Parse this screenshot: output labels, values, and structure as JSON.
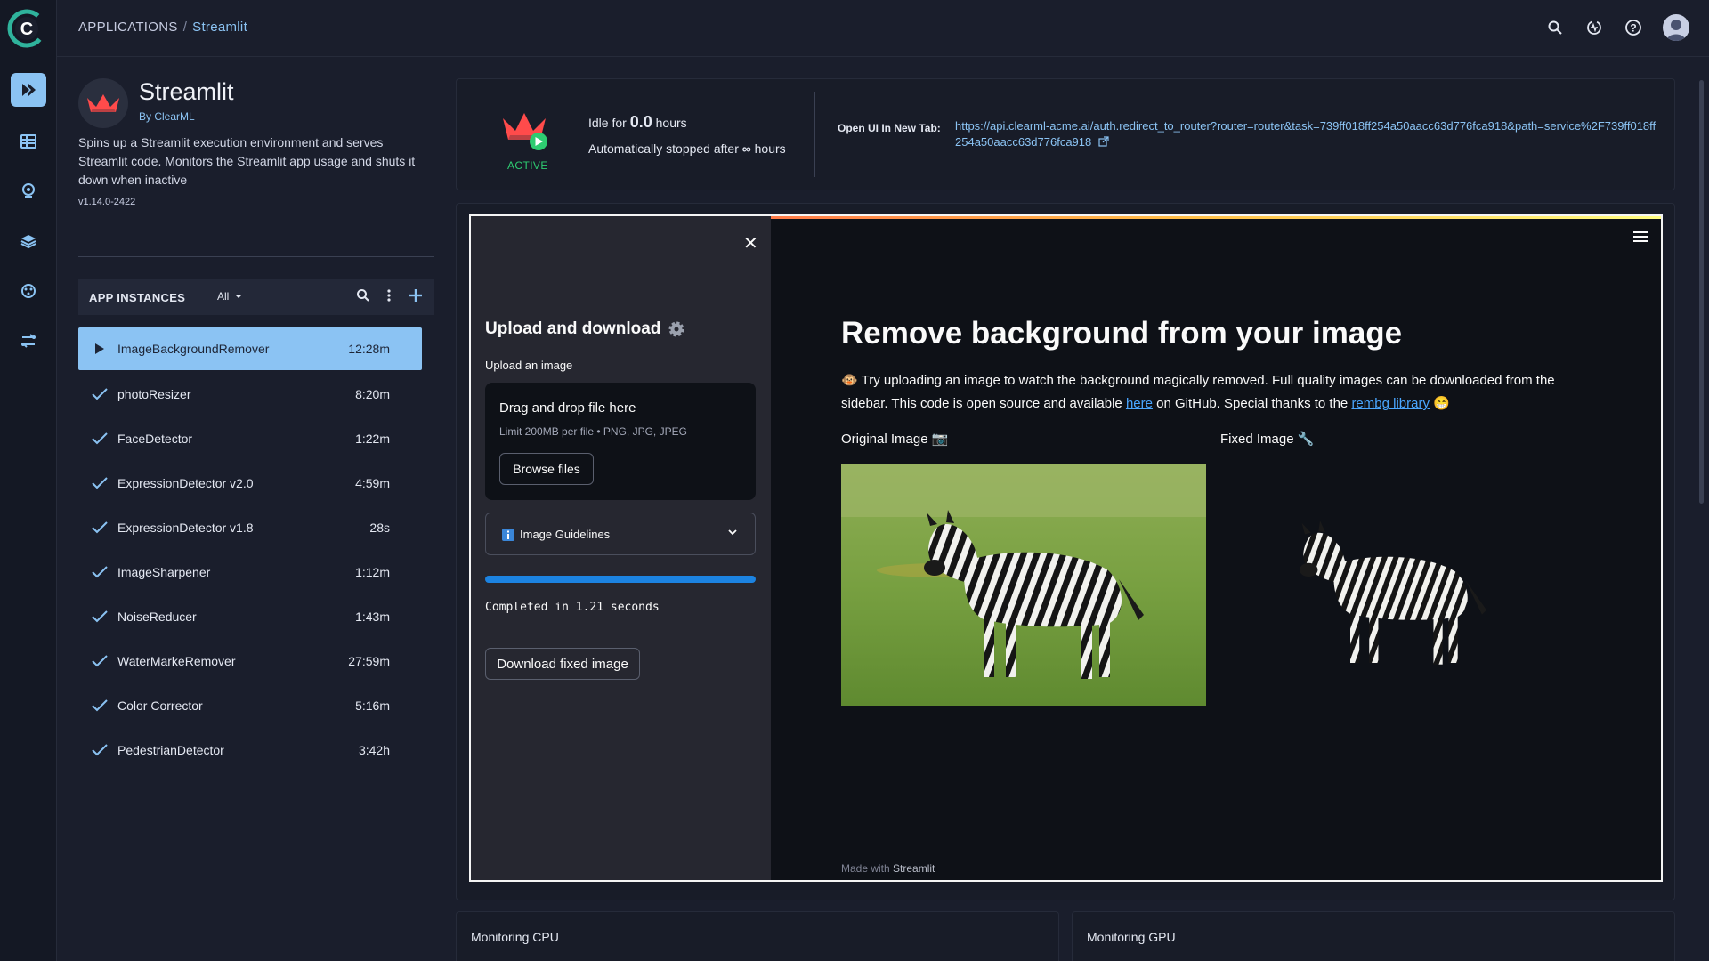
{
  "breadcrumb": {
    "root": "APPLICATIONS",
    "separator": "/",
    "current": "Streamlit"
  },
  "top_icons": [
    "search-icon",
    "activity-icon",
    "help-icon",
    "user-avatar"
  ],
  "app": {
    "title": "Streamlit",
    "by": "By ClearML",
    "description": "Spins up a Streamlit execution environment and serves Streamlit code. Monitors the Streamlit app usage and shuts it down when inactive",
    "version": "v1.14.0-2422"
  },
  "instances": {
    "title": "APP INSTANCES",
    "filter": "All",
    "items": [
      {
        "name": "ImageBackgroundRemover",
        "time": "12:28m",
        "status": "running"
      },
      {
        "name": "photoResizer",
        "time": "8:20m",
        "status": "completed"
      },
      {
        "name": "FaceDetector",
        "time": "1:22m",
        "status": "completed"
      },
      {
        "name": "ExpressionDetector v2.0",
        "time": "4:59m",
        "status": "completed"
      },
      {
        "name": "ExpressionDetector v1.8",
        "time": "28s",
        "status": "completed"
      },
      {
        "name": "ImageSharpener",
        "time": "1:12m",
        "status": "completed"
      },
      {
        "name": "NoiseReducer",
        "time": "1:43m",
        "status": "completed"
      },
      {
        "name": "WaterMarkeRemover",
        "time": "27:59m",
        "status": "completed"
      },
      {
        "name": "Color Corrector",
        "time": "5:16m",
        "status": "completed"
      },
      {
        "name": "PedestrianDetector",
        "time": "3:42h",
        "status": "completed"
      }
    ]
  },
  "status": {
    "state": "ACTIVE",
    "idle_prefix": "Idle for",
    "idle_value": "0.0",
    "idle_suffix": "hours",
    "auto_prefix": "Automatically stopped after",
    "auto_value": "∞",
    "auto_suffix": "hours",
    "open_label": "Open UI In New Tab:",
    "open_url": "https://api.clearml-acme.ai/auth.redirect_to_router?router=router&task=739ff018ff254a50aacc63d776fca918&path=service%2F739ff018ff254a50aacc63d776fca918"
  },
  "streamlit": {
    "sidebar_title": "Upload and download",
    "upload_label": "Upload an image",
    "drop_title": "Drag and drop file here",
    "drop_limit": "Limit 200MB per file • PNG, JPG, JPEG",
    "browse_label": "Browse files",
    "guidelines_label": "Image Guidelines",
    "progress": 1.0,
    "completed_text": "Completed in 1.21 seconds",
    "download_label": "Download fixed image",
    "heading": "Remove background from your image",
    "intro_emoji": "🐵",
    "intro_pre": "Try uploading an image to watch the background magically removed. Full quality images can be downloaded from the sidebar. This code is open source and available ",
    "intro_link1": "here",
    "intro_mid": " on GitHub. Special thanks to the ",
    "intro_link2": "rembg library",
    "intro_end_emoji": "😁",
    "caption_original": "Original Image 📷",
    "caption_fixed": "Fixed Image 🔧",
    "footer_prefix": "Made with",
    "footer_brand": "Streamlit"
  },
  "monitoring": {
    "cpu": "Monitoring CPU",
    "gpu": "Monitoring GPU"
  },
  "colors": {
    "accent": "#8bc3f3",
    "active": "#2ecc71",
    "streamlit_red": "#ff4b4b",
    "progress": "#1c83e1"
  }
}
